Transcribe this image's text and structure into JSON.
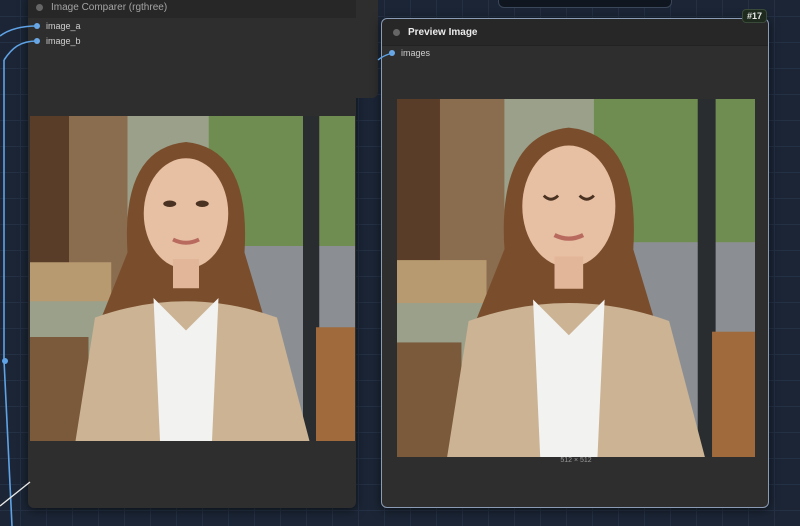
{
  "node_a": {
    "title": "Image Comparer (rgthree)",
    "inputs": [
      "image_a",
      "image_b"
    ]
  },
  "node_b": {
    "title": "Preview Image",
    "badge": "#17",
    "input": "images",
    "dimensions": "512 × 512"
  },
  "colors": {
    "canvas": "#1b2535",
    "node_body": "#2e2e2e",
    "slot": "#6aa8e6",
    "wire": "#5fa3e6"
  },
  "icons": {
    "node_dot": "circle-icon",
    "slot": "input-slot-icon"
  }
}
